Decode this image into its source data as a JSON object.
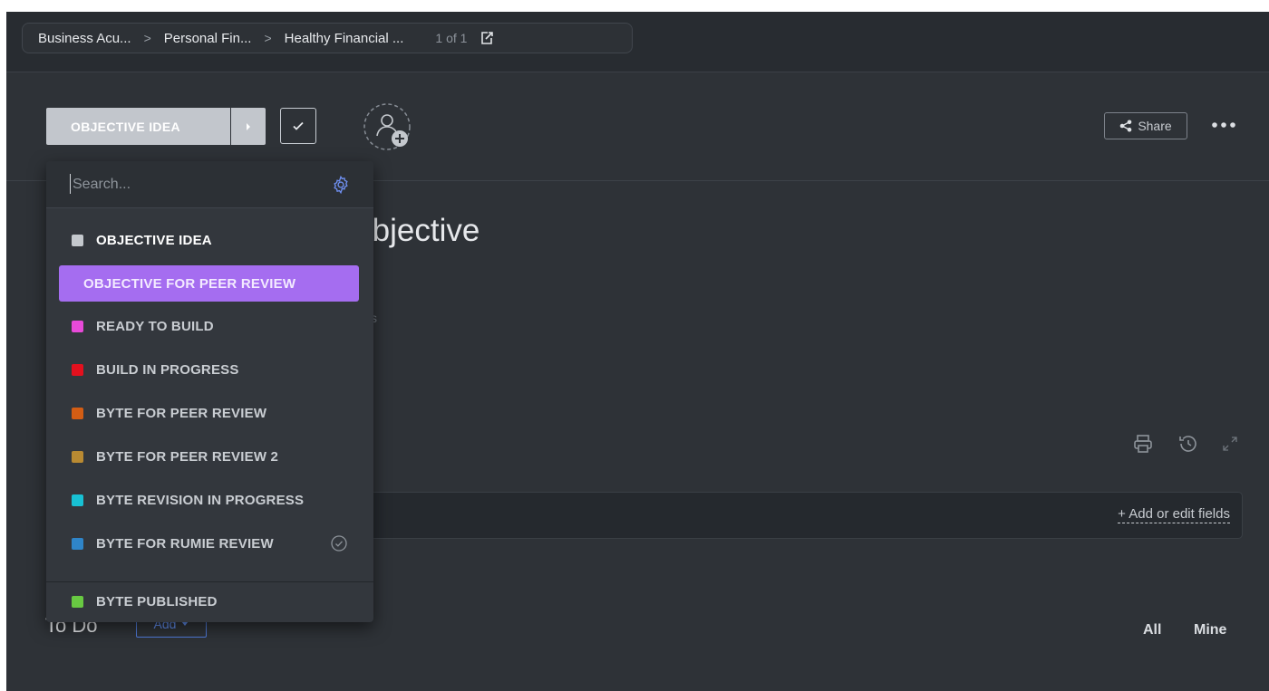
{
  "breadcrumb": {
    "items": [
      "Business Acu...",
      "Personal Fin...",
      "Healthy Financial ..."
    ],
    "separator": ">",
    "count": "1 of 1"
  },
  "task": {
    "status_label": "OBJECTIVE IDEA",
    "title_fragment": ")bjective",
    "sub_fragment": "s"
  },
  "header": {
    "share_label": "Share"
  },
  "fields": {
    "add_edit_label": "+ Add or edit fields"
  },
  "todo": {
    "title": "To Do",
    "add_label": "Add",
    "filter_all": "All",
    "filter_mine": "Mine"
  },
  "status_dropdown": {
    "search_placeholder": "Search...",
    "options": [
      {
        "label": "OBJECTIVE IDEA",
        "color": "#c4c8cd",
        "state": "current"
      },
      {
        "label": "OBJECTIVE FOR PEER REVIEW",
        "color": "#a56df0",
        "state": "highlighted"
      },
      {
        "label": "READY TO BUILD",
        "color": "#e84ad9",
        "state": ""
      },
      {
        "label": "BUILD IN PROGRESS",
        "color": "#e3101e",
        "state": ""
      },
      {
        "label": "BYTE FOR PEER REVIEW",
        "color": "#d35d14",
        "state": ""
      },
      {
        "label": "BYTE FOR PEER REVIEW 2",
        "color": "#b98a32",
        "state": ""
      },
      {
        "label": "BYTE REVISION IN PROGRESS",
        "color": "#18c1d4",
        "state": ""
      },
      {
        "label": "BYTE FOR RUMIE REVIEW",
        "color": "#2f85c9",
        "state": "done-check"
      },
      {
        "label": "BYTE PUBLISHED",
        "color": "#68c942",
        "state": ""
      }
    ]
  },
  "colors": {
    "background": "#2e3237",
    "accent_purple": "#a56df0",
    "accent_blue": "#5f8bea"
  }
}
